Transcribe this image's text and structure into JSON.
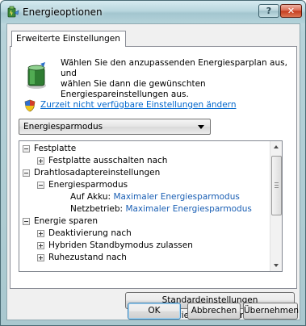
{
  "window": {
    "title": "Energieoptionen",
    "help_glyph": "?",
    "close_glyph": "✕"
  },
  "tab": {
    "label": "Erweiterte Einstellungen"
  },
  "intro": {
    "line1": "Wählen Sie den anzupassenden Energiesparplan aus, und",
    "line2": "wählen Sie dann die gewünschten",
    "line3": "Energiespareinstellungen aus."
  },
  "change_link": "Zurzeit nicht verfügbare Einstellungen ändern",
  "plan_combo": {
    "selected": "Energiesparmodus"
  },
  "tree": {
    "rows": [
      {
        "label": "Festplatte",
        "expander": "minus"
      },
      {
        "label": "Festplatte ausschalten nach",
        "expander": "plus"
      },
      {
        "label": "Drahtlosadaptereinstellungen",
        "expander": "minus"
      },
      {
        "label": "Energiesparmodus",
        "expander": "minus"
      },
      {
        "label": "Auf Akku:",
        "value": "Maximaler Energiesparmodus"
      },
      {
        "label": "Netzbetrieb:",
        "value": "Maximaler Energiesparmodus"
      },
      {
        "label": "Energie sparen",
        "expander": "minus"
      },
      {
        "label": "Deaktivierung nach",
        "expander": "plus"
      },
      {
        "label": "Hybriden Standbymodus zulassen",
        "expander": "plus"
      },
      {
        "label": "Ruhezustand nach",
        "expander": "plus"
      }
    ]
  },
  "buttons": {
    "restore": "Standardeinstellungen wiederherstellen",
    "ok": "OK",
    "cancel": "Abbrechen",
    "apply": "Übernehmen"
  }
}
